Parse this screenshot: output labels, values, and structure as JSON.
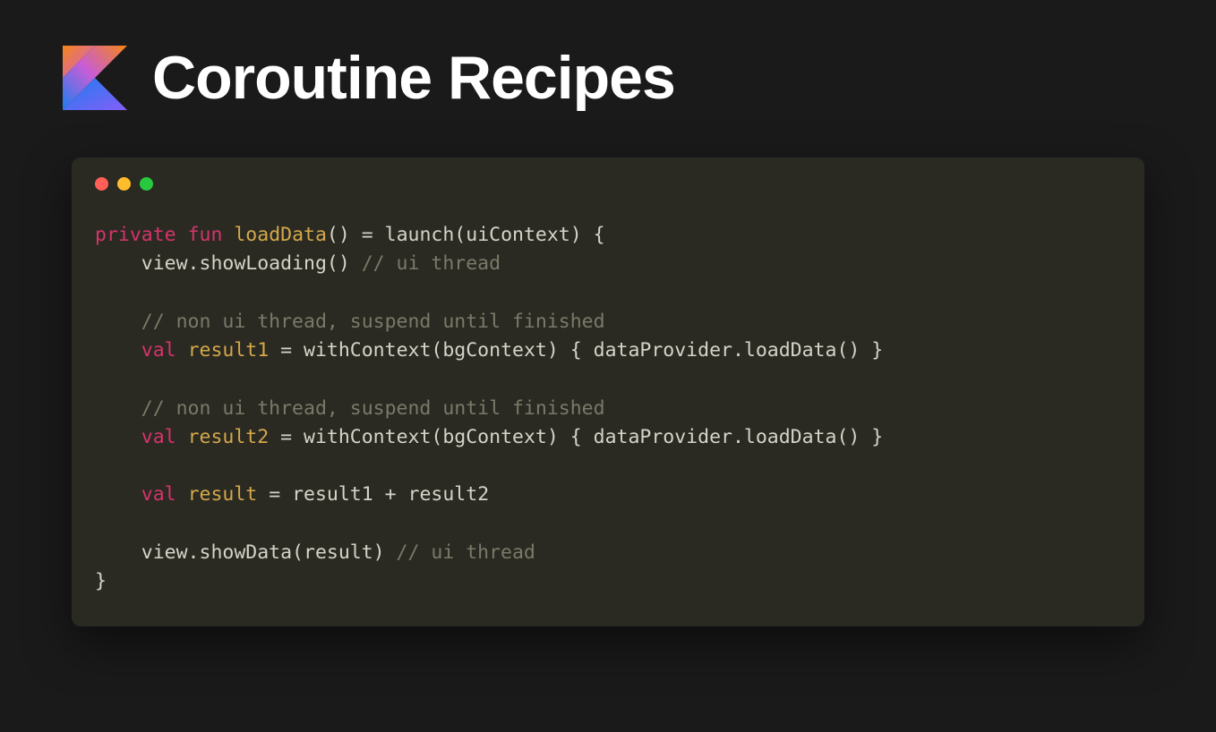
{
  "header": {
    "title": "Coroutine Recipes"
  },
  "window": {
    "controls": {
      "red": "close",
      "yellow": "minimize",
      "green": "maximize"
    }
  },
  "code": {
    "line1_kw1": "private",
    "line1_kw2": "fun",
    "line1_fn": "loadData",
    "line1_rest": "() = launch(uiContext) {",
    "line2_text": "    view.showLoading() ",
    "line2_comment": "// ui thread",
    "line3": "",
    "line4_comment": "    // non ui thread, suspend until finished",
    "line5_kw": "val",
    "line5_var": "result1",
    "line5_rest": " = withContext(bgContext) { dataProvider.loadData() }",
    "line6": "",
    "line7_comment": "    // non ui thread, suspend until finished",
    "line8_kw": "val",
    "line8_var": "result2",
    "line8_rest": " = withContext(bgContext) { dataProvider.loadData() }",
    "line9": "",
    "line10_kw": "val",
    "line10_var": "result",
    "line10_rest": " = result1 + result2",
    "line11": "",
    "line12_text": "    view.showData(result) ",
    "line12_comment": "// ui thread",
    "line13": "}"
  }
}
